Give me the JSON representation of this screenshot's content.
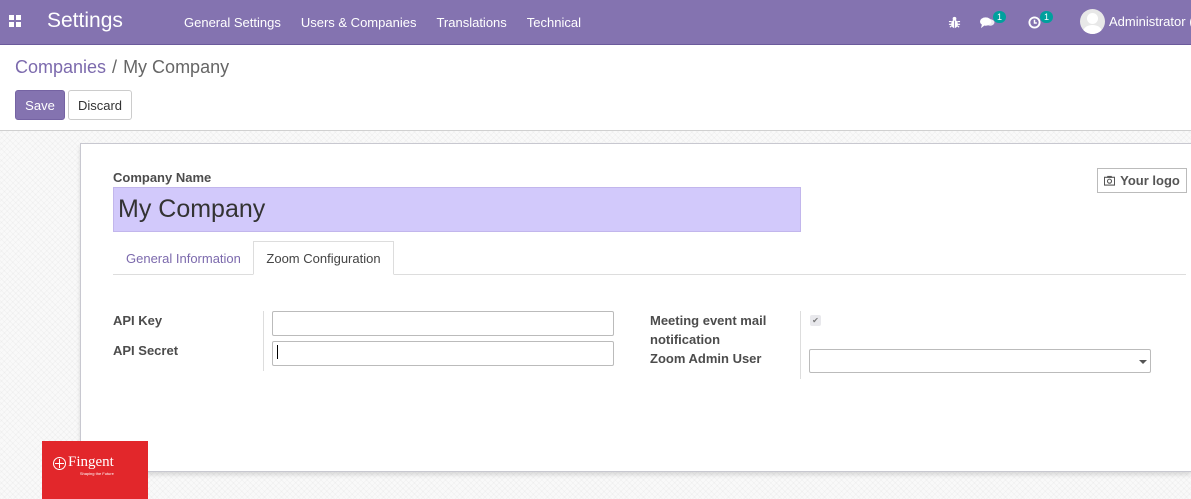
{
  "nav": {
    "app_title": "Settings",
    "menu": [
      "General Settings",
      "Users & Companies",
      "Translations",
      "Technical"
    ],
    "messages_count": "1",
    "activities_count": "1",
    "user_name": "Administrator ("
  },
  "breadcrumb": {
    "parent": "Companies",
    "separator": "/",
    "current": "My Company"
  },
  "buttons": {
    "save": "Save",
    "discard": "Discard"
  },
  "form": {
    "logo_button": "Your logo",
    "company_name_label": "Company Name",
    "company_name_value": "My Company",
    "tabs": [
      "General Information",
      "Zoom Configuration"
    ],
    "active_tab": "Zoom Configuration",
    "api_key_label": "API Key",
    "api_key_value": "",
    "api_secret_label": "API Secret",
    "api_secret_value": "",
    "meeting_mail_label_line1": "Meeting event mail",
    "meeting_mail_label_line2": "notification",
    "meeting_mail_checked": true,
    "zoom_admin_label": "Zoom Admin User",
    "zoom_admin_value": ""
  },
  "watermark": {
    "brand": "Fingent",
    "tagline": "Shaping the Future"
  },
  "colors": {
    "nav_bg": "#8473b0",
    "primary": "#8473b0",
    "link": "#7c6aad",
    "required_field": "#d2c9fb",
    "badge": "#00a09d",
    "brand_red": "#e2272b"
  }
}
